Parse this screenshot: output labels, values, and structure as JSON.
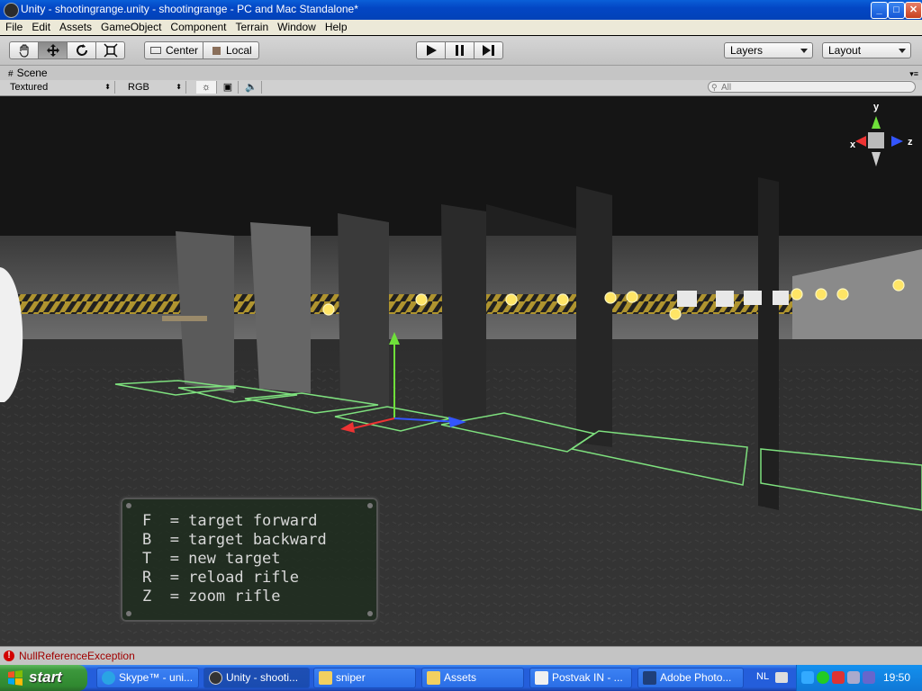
{
  "window": {
    "title": "Unity - shootingrange.unity - shootingrange - PC and Mac Standalone*",
    "min_label": "_",
    "max_label": "□",
    "close_label": "✕"
  },
  "menu": [
    "File",
    "Edit",
    "Assets",
    "GameObject",
    "Component",
    "Terrain",
    "Window",
    "Help"
  ],
  "toolbar": {
    "pivot_label": "Center",
    "space_label": "Local",
    "layers_label": "Layers",
    "layout_label": "Layout"
  },
  "scene": {
    "tab_label": "Scene",
    "render_mode": "Textured",
    "channel_mode": "RGB",
    "search_placeholder": "All",
    "gizmo_axes": {
      "x": "x",
      "y": "y",
      "z": "z"
    }
  },
  "hud": {
    "lines": [
      "F  = target forward",
      "B  = target backward",
      "T  = new target",
      "R  = reload rifle",
      "Z  = zoom rifle"
    ]
  },
  "status": {
    "message": "NullReferenceException"
  },
  "taskbar": {
    "start_label": "start",
    "tasks": [
      {
        "label": "Skype™ - uni..."
      },
      {
        "label": "Unity - shooti..."
      },
      {
        "label": "sniper"
      },
      {
        "label": "Assets"
      },
      {
        "label": "Postvak IN - ..."
      },
      {
        "label": "Adobe Photo..."
      }
    ],
    "language": "NL",
    "clock": "19:50"
  },
  "colors": {
    "titlebar": "#0346c4",
    "error": "#a00000",
    "taskbar": "#245edb",
    "start": "#3c973c"
  }
}
